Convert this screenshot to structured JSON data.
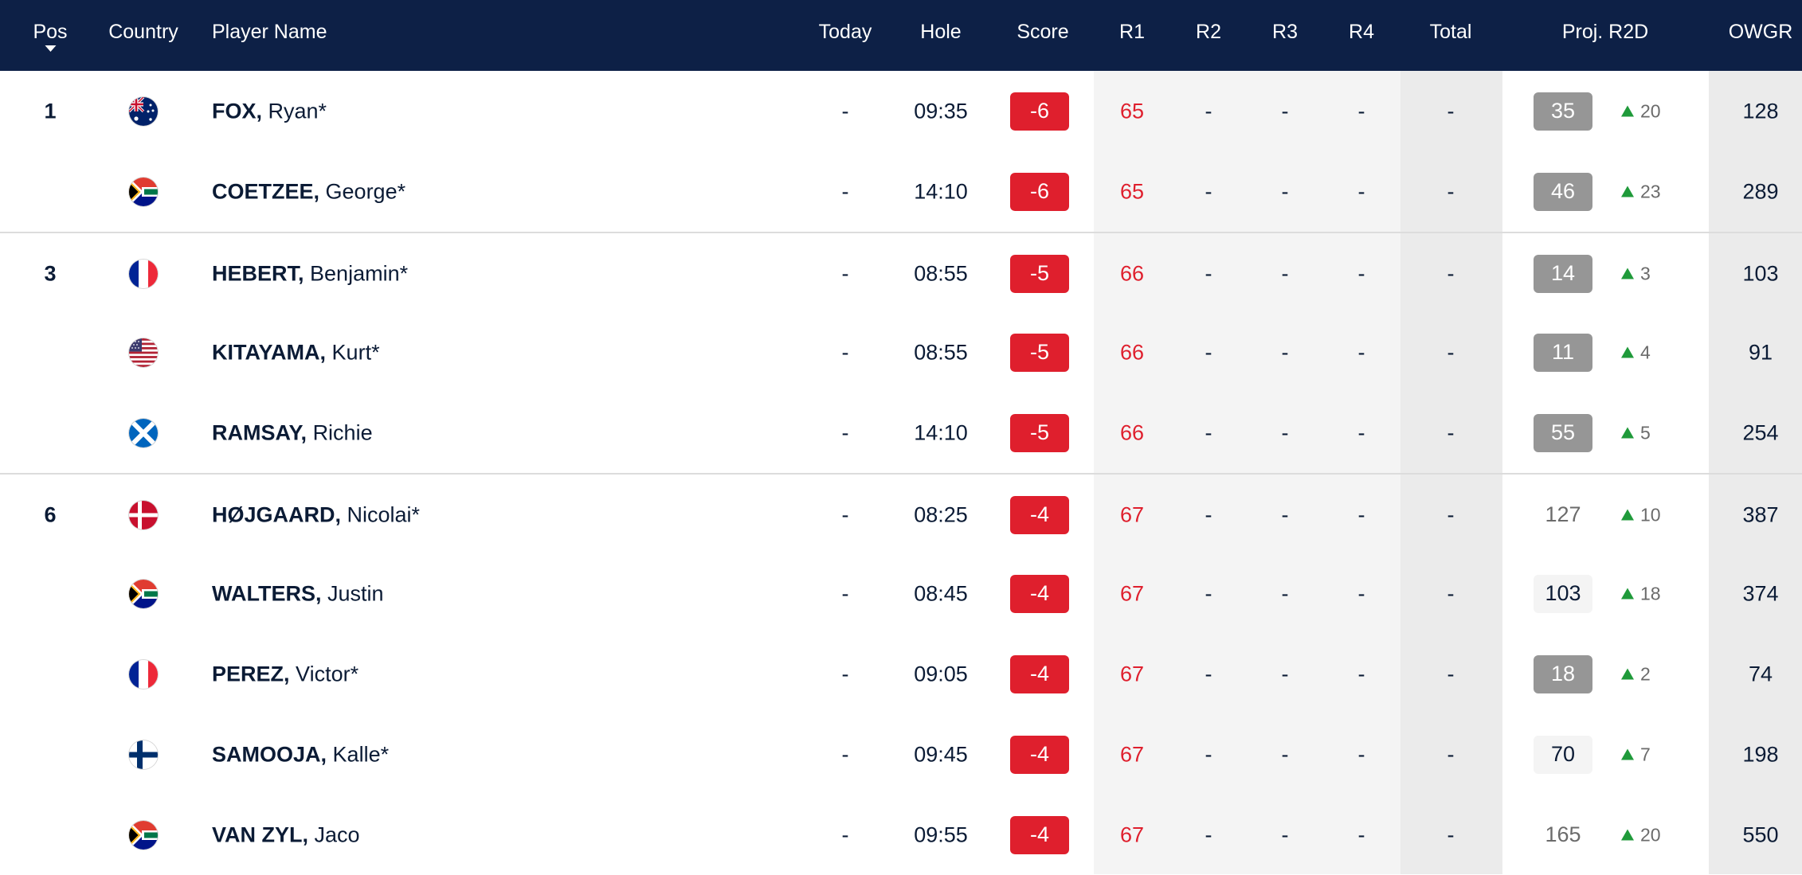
{
  "columns": {
    "pos": "Pos",
    "country": "Country",
    "player": "Player Name",
    "today": "Today",
    "hole": "Hole",
    "score": "Score",
    "r1": "R1",
    "r2": "R2",
    "r3": "R3",
    "r4": "R4",
    "total": "Total",
    "proj": "Proj. R2D",
    "owgr": "OWGR"
  },
  "colors": {
    "header_bg": "#0d2046",
    "score_badge": "#df1f2d",
    "r1_text": "#df1f2d",
    "up_arrow": "#1f9a3a",
    "proj_dark": "#969696",
    "proj_light": "#f4f4f4"
  },
  "rows": [
    {
      "pos": "1",
      "flag": "australia-flag",
      "last": "FOX,",
      "first": "Ryan*",
      "today": "-",
      "hole": "09:35",
      "score": "-6",
      "r1": "65",
      "r2": "-",
      "r3": "-",
      "r4": "-",
      "total": "-",
      "proj": "35",
      "proj_style": "dark",
      "move": "20",
      "owgr": "128"
    },
    {
      "pos": "",
      "flag": "south-africa-flag",
      "last": "COETZEE,",
      "first": "George*",
      "today": "-",
      "hole": "14:10",
      "score": "-6",
      "r1": "65",
      "r2": "-",
      "r3": "-",
      "r4": "-",
      "total": "-",
      "proj": "46",
      "proj_style": "dark",
      "move": "23",
      "owgr": "289"
    },
    {
      "pos": "3",
      "flag": "france-flag",
      "last": "HEBERT,",
      "first": "Benjamin*",
      "today": "-",
      "hole": "08:55",
      "score": "-5",
      "r1": "66",
      "r2": "-",
      "r3": "-",
      "r4": "-",
      "total": "-",
      "proj": "14",
      "proj_style": "dark",
      "move": "3",
      "owgr": "103"
    },
    {
      "pos": "",
      "flag": "usa-flag",
      "last": "KITAYAMA,",
      "first": "Kurt*",
      "today": "-",
      "hole": "08:55",
      "score": "-5",
      "r1": "66",
      "r2": "-",
      "r3": "-",
      "r4": "-",
      "total": "-",
      "proj": "11",
      "proj_style": "dark",
      "move": "4",
      "owgr": "91"
    },
    {
      "pos": "",
      "flag": "scotland-flag",
      "last": "RAMSAY,",
      "first": "Richie",
      "today": "-",
      "hole": "14:10",
      "score": "-5",
      "r1": "66",
      "r2": "-",
      "r3": "-",
      "r4": "-",
      "total": "-",
      "proj": "55",
      "proj_style": "dark",
      "move": "5",
      "owgr": "254"
    },
    {
      "pos": "6",
      "flag": "denmark-flag",
      "last": "HØJGAARD,",
      "first": "Nicolai*",
      "today": "-",
      "hole": "08:25",
      "score": "-4",
      "r1": "67",
      "r2": "-",
      "r3": "-",
      "r4": "-",
      "total": "-",
      "proj": "127",
      "proj_style": "plain",
      "move": "10",
      "owgr": "387"
    },
    {
      "pos": "",
      "flag": "south-africa-flag",
      "last": "WALTERS,",
      "first": "Justin",
      "today": "-",
      "hole": "08:45",
      "score": "-4",
      "r1": "67",
      "r2": "-",
      "r3": "-",
      "r4": "-",
      "total": "-",
      "proj": "103",
      "proj_style": "light",
      "move": "18",
      "owgr": "374"
    },
    {
      "pos": "",
      "flag": "france-flag",
      "last": "PEREZ,",
      "first": "Victor*",
      "today": "-",
      "hole": "09:05",
      "score": "-4",
      "r1": "67",
      "r2": "-",
      "r3": "-",
      "r4": "-",
      "total": "-",
      "proj": "18",
      "proj_style": "dark",
      "move": "2",
      "owgr": "74"
    },
    {
      "pos": "",
      "flag": "finland-flag",
      "last": "SAMOOJA,",
      "first": "Kalle*",
      "today": "-",
      "hole": "09:45",
      "score": "-4",
      "r1": "67",
      "r2": "-",
      "r3": "-",
      "r4": "-",
      "total": "-",
      "proj": "70",
      "proj_style": "light",
      "move": "7",
      "owgr": "198"
    },
    {
      "pos": "",
      "flag": "south-africa-flag",
      "last": "VAN ZYL,",
      "first": "Jaco",
      "today": "-",
      "hole": "09:55",
      "score": "-4",
      "r1": "67",
      "r2": "-",
      "r3": "-",
      "r4": "-",
      "total": "-",
      "proj": "165",
      "proj_style": "plain",
      "move": "20",
      "owgr": "550"
    }
  ]
}
